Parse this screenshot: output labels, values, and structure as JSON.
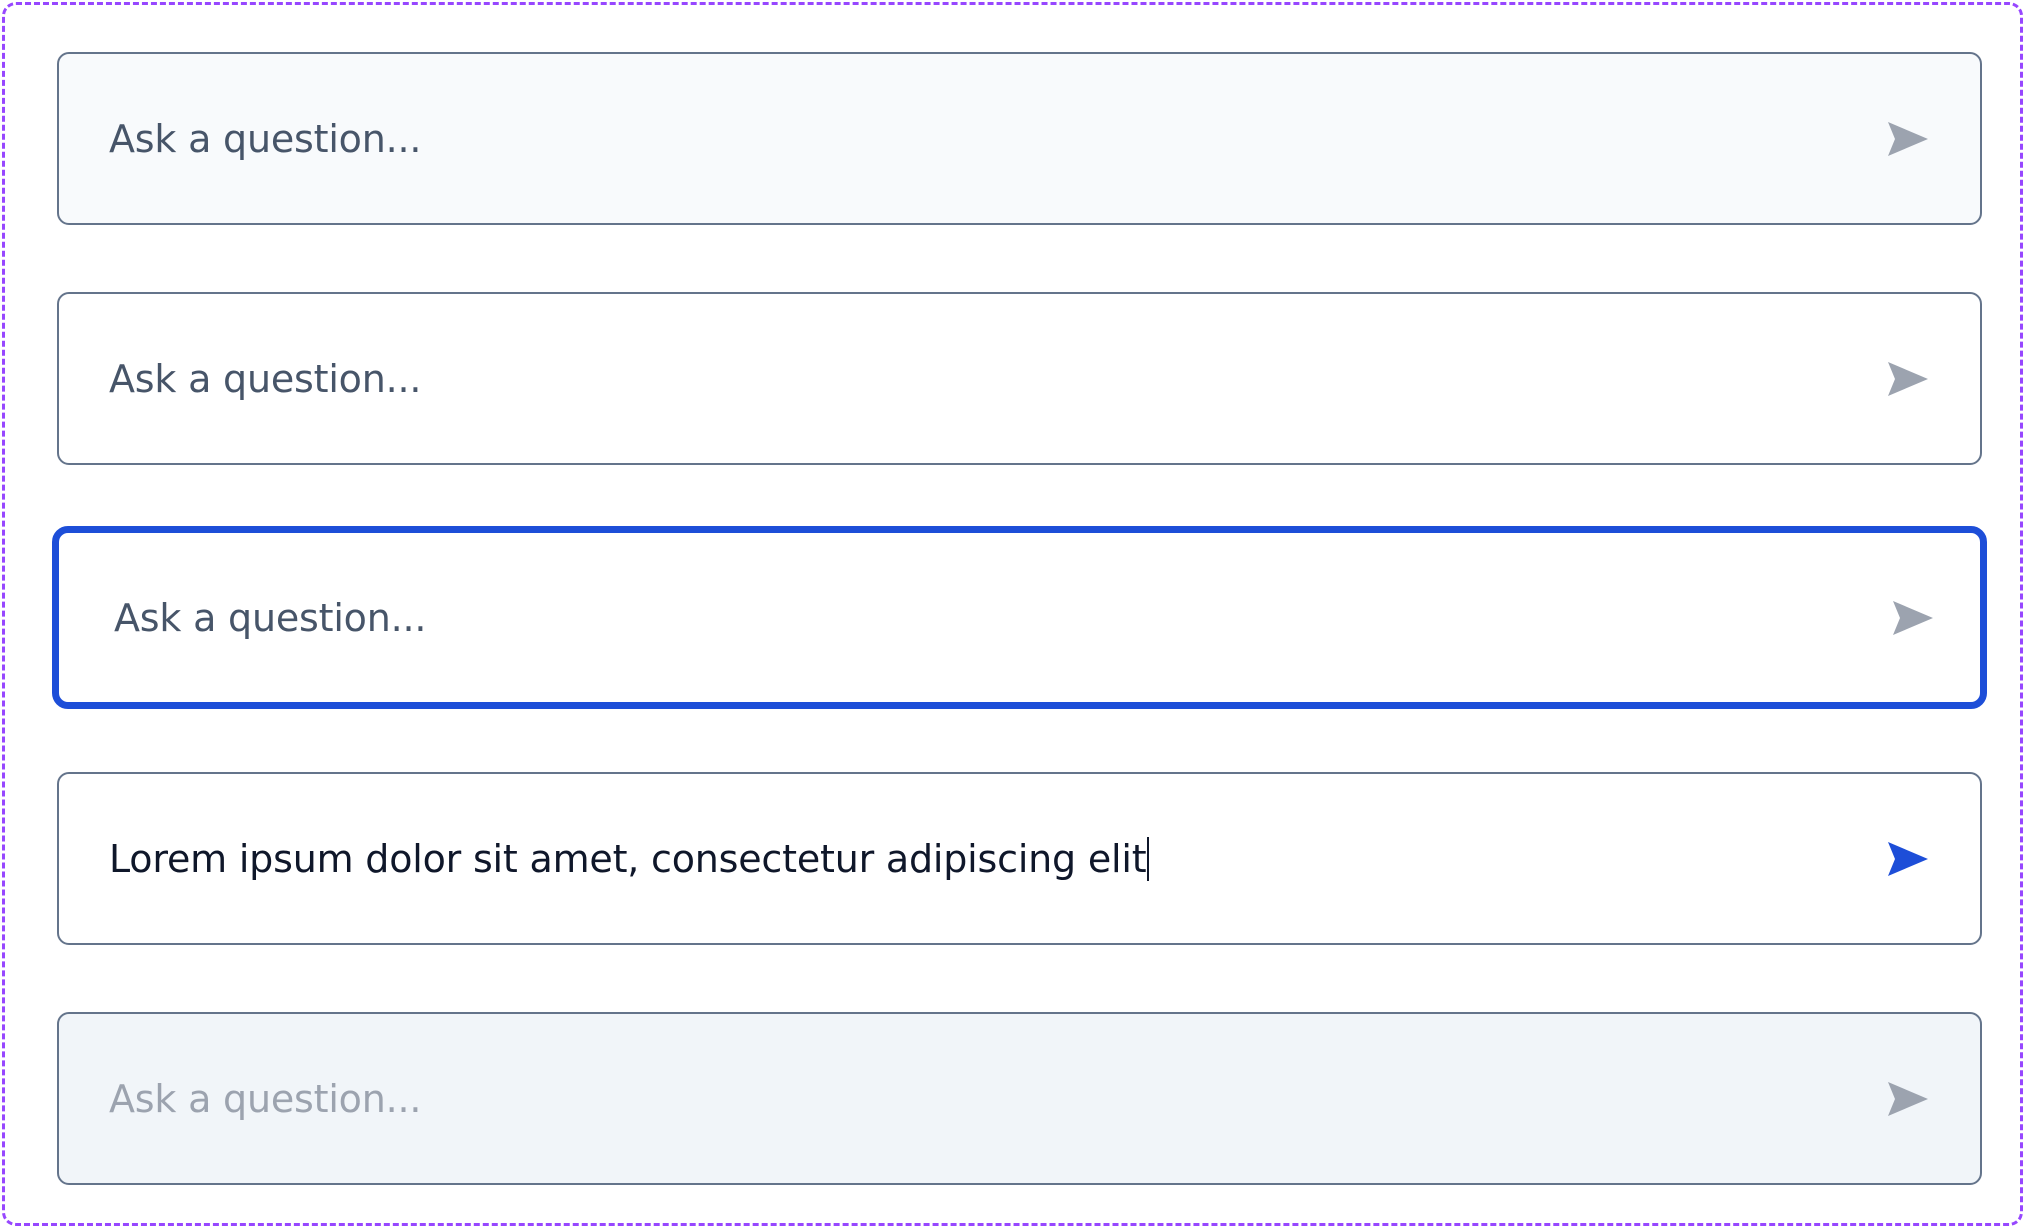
{
  "colors": {
    "frame_border": "#9747ff",
    "field_border": "#64748b",
    "focus_border": "#1d4ed8",
    "placeholder_text": "#475569",
    "filled_text": "#0f172a",
    "disabled_text": "#9ca3af",
    "send_icon_inactive": "#9ca3af",
    "send_icon_active": "#1d4ed8"
  },
  "inputs": [
    {
      "state": "hover",
      "text": "Ask a question...",
      "icon": "send-icon"
    },
    {
      "state": "default",
      "text": "Ask a question...",
      "icon": "send-icon"
    },
    {
      "state": "focus",
      "text": "Ask a question...",
      "icon": "send-icon"
    },
    {
      "state": "filled",
      "text": "Lorem ipsum dolor sit amet, consectetur adipiscing elit",
      "icon": "send-icon"
    },
    {
      "state": "disabled",
      "text": "Ask a question...",
      "icon": "send-icon"
    }
  ]
}
